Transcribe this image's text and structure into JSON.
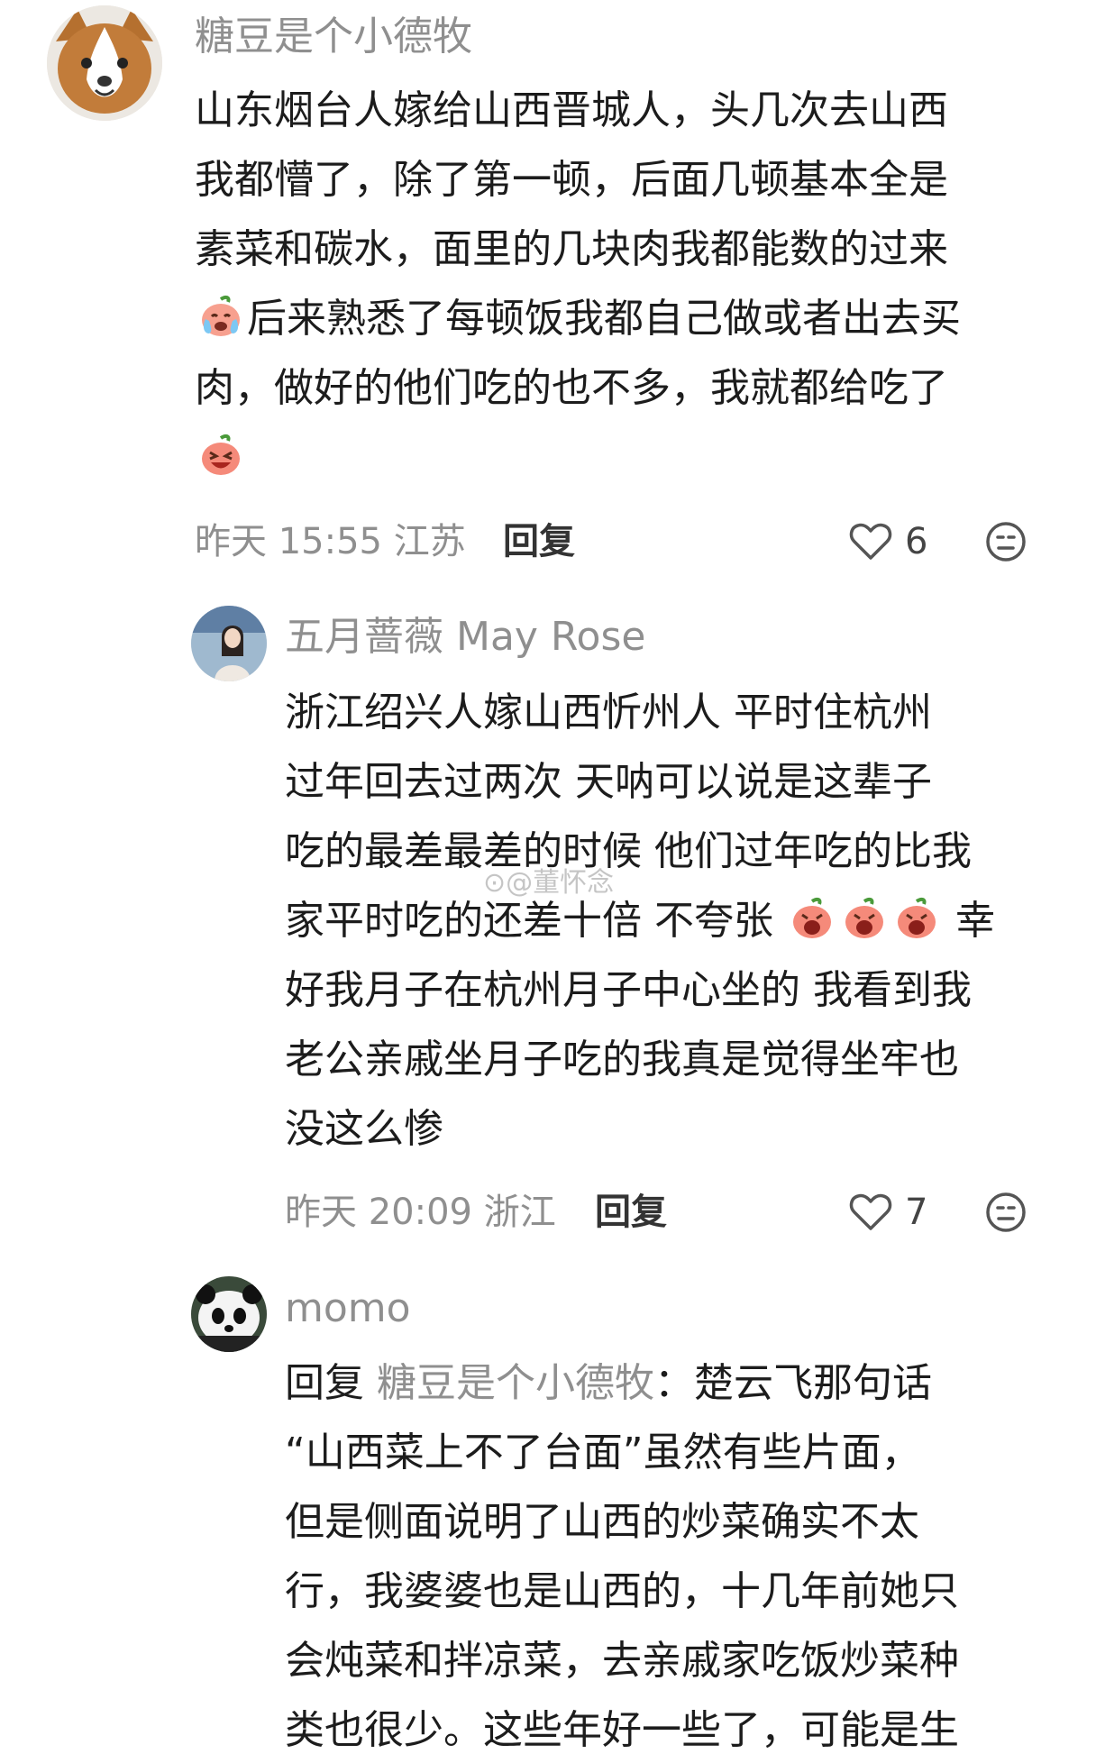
{
  "comments": [
    {
      "username": "糖豆是个小德牧",
      "lines": [
        "山东烟台人嫁给山西晋城人，头几次去山西",
        "我都懵了，除了第一顿，后面几顿基本全是",
        "素菜和碳水，面里的几块肉我都能数的过来",
        "后来熟悉了每顿饭我都自己做或者出去买",
        "肉，做好的他们吃的也不多，我就都给吃了"
      ],
      "time_location": "昨天 15:55 江苏",
      "reply_label": "回复",
      "likes": "6"
    },
    {
      "username": "五月蔷薇 May Rose",
      "lines": [
        "浙江绍兴人嫁山西忻州人  平时住杭州",
        "过年回去过两次  天呐可以说是这辈子",
        "吃的最差最差的时候 他们过年吃的比我",
        "家平时吃的还差十倍 不夸张",
        "好我月子在杭州月子中心坐的 我看到我",
        "老公亲戚坐月子吃的我真是觉得坐牢也",
        "没这么惨"
      ],
      "line4_suffix": "幸",
      "time_location": "昨天 20:09 浙江",
      "reply_label": "回复",
      "likes": "7"
    },
    {
      "username": "momo",
      "reply_prefix": "回复",
      "reply_target": "糖豆是个小德牧",
      "lines": [
        "：楚云飞那句话",
        "“山西菜上不了台面”虽然有些片面，",
        "但是侧面说明了山西的炒菜确实不太",
        "行，我婆婆也是山西的，十几年前她只",
        "会炖菜和拌凉菜，去亲戚家吃饭炒菜种",
        "类也很少。这些年好一些了，可能是生"
      ]
    }
  ],
  "watermark": "@董怀念",
  "icons": {
    "like": "heart-outline-icon",
    "dislike": "unhappy-face-icon",
    "emoji_cry": "crying-peach-emoji",
    "emoji_laugh": "laughing-peach-emoji",
    "emoji_wail": "wailing-peach-emoji"
  }
}
